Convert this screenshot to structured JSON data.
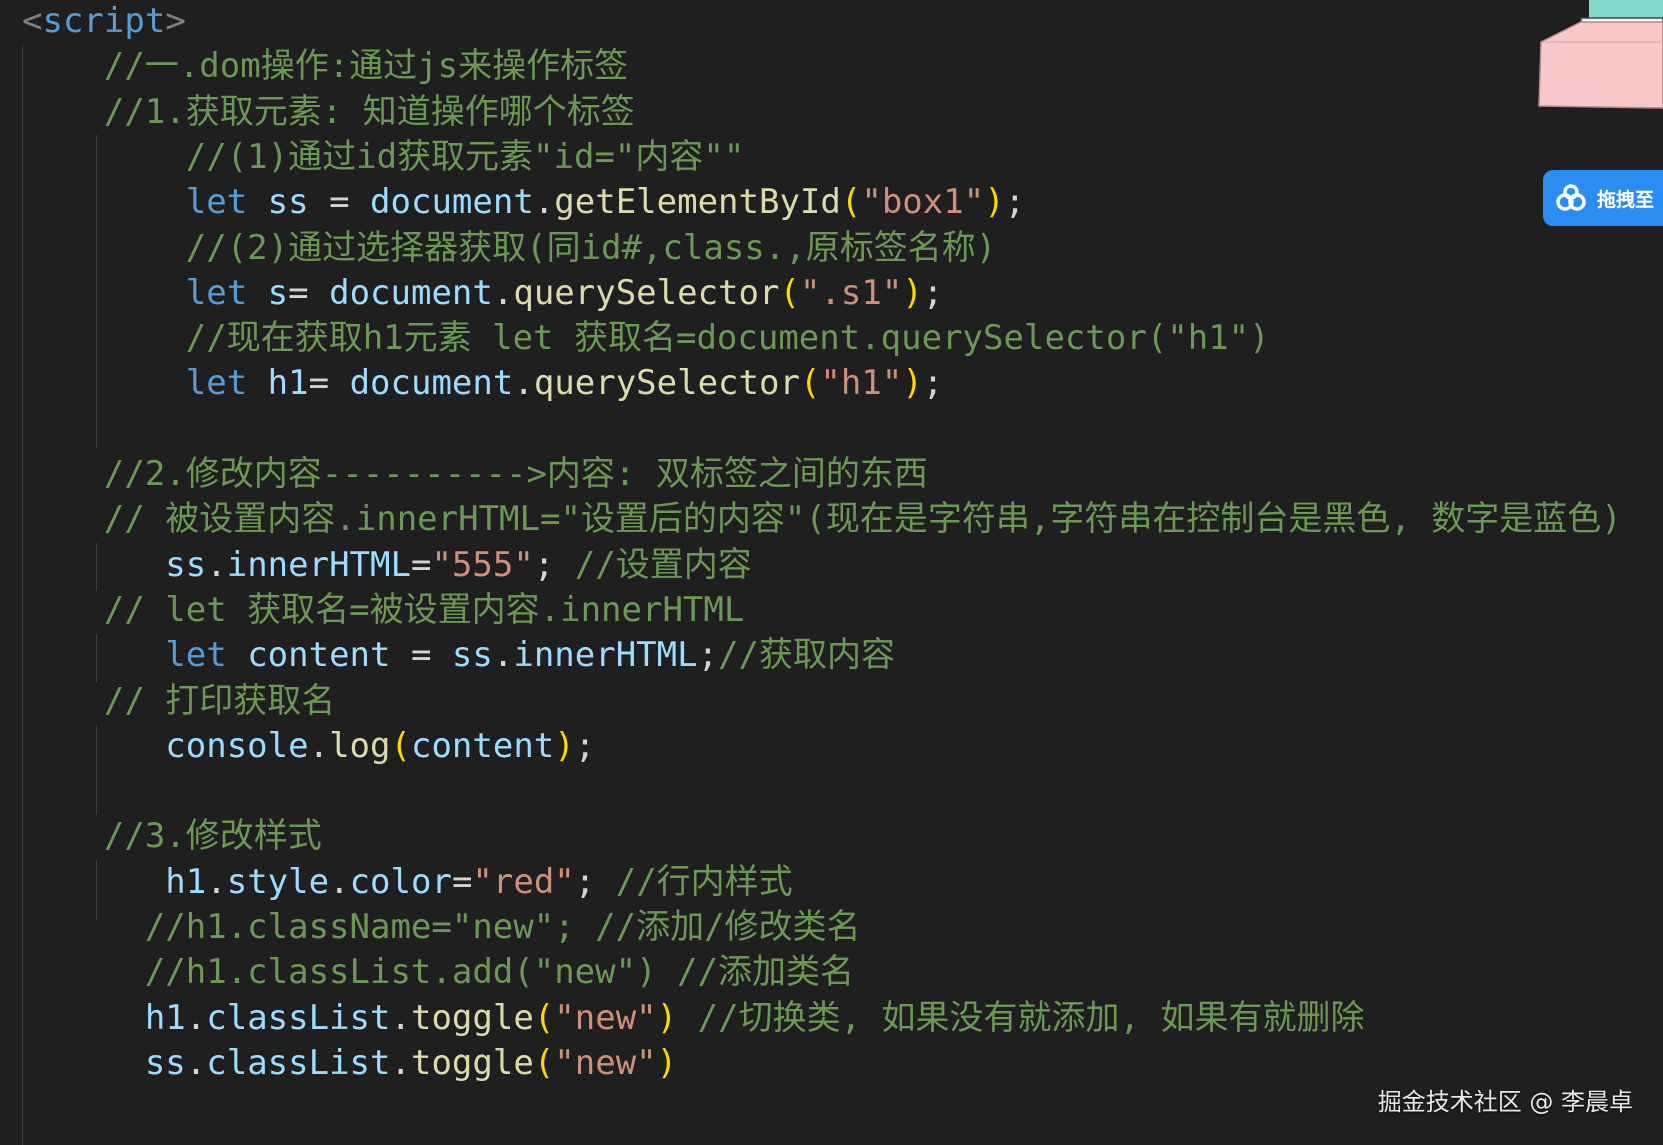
{
  "editor": {
    "colors": {
      "background": "#1f1f1f",
      "comment": "#6a9955",
      "keyword": "#569cd6",
      "variable": "#9cdcfe",
      "function": "#dcdcaa",
      "string": "#ce9178",
      "bracket": "#ffd700",
      "punctuation": "#d4d4d4"
    },
    "lines": [
      [
        {
          "t": "tag",
          "v": "<"
        },
        {
          "t": "tn",
          "v": "script"
        },
        {
          "t": "tag",
          "v": ">"
        }
      ],
      [
        {
          "t": "c",
          "v": "    //一.dom操作:通过js来操作标签"
        }
      ],
      [
        {
          "t": "c",
          "v": "    //1.获取元素: 知道操作哪个标签"
        }
      ],
      [
        {
          "t": "c",
          "v": "        //(1)通过id获取元素\"id=\"内容\"\""
        }
      ],
      [
        {
          "t": "p",
          "v": "        "
        },
        {
          "t": "k",
          "v": "let"
        },
        {
          "t": "p",
          "v": " "
        },
        {
          "t": "v",
          "v": "ss"
        },
        {
          "t": "p",
          "v": " = "
        },
        {
          "t": "v",
          "v": "document"
        },
        {
          "t": "p",
          "v": "."
        },
        {
          "t": "f",
          "v": "getElementById"
        },
        {
          "t": "b",
          "v": "("
        },
        {
          "t": "s",
          "v": "\"box1\""
        },
        {
          "t": "b",
          "v": ")"
        },
        {
          "t": "p",
          "v": ";"
        }
      ],
      [
        {
          "t": "c",
          "v": "        //(2)通过选择器获取(同id#,class.,原标签名称)"
        }
      ],
      [
        {
          "t": "p",
          "v": "        "
        },
        {
          "t": "k",
          "v": "let"
        },
        {
          "t": "p",
          "v": " "
        },
        {
          "t": "v",
          "v": "s"
        },
        {
          "t": "p",
          "v": "= "
        },
        {
          "t": "v",
          "v": "document"
        },
        {
          "t": "p",
          "v": "."
        },
        {
          "t": "f",
          "v": "querySelector"
        },
        {
          "t": "b",
          "v": "("
        },
        {
          "t": "s",
          "v": "\".s1\""
        },
        {
          "t": "b",
          "v": ")"
        },
        {
          "t": "p",
          "v": ";"
        }
      ],
      [
        {
          "t": "c",
          "v": "        //现在获取h1元素 let 获取名=document.querySelector(\"h1\")"
        }
      ],
      [
        {
          "t": "p",
          "v": "        "
        },
        {
          "t": "k",
          "v": "let"
        },
        {
          "t": "p",
          "v": " "
        },
        {
          "t": "v",
          "v": "h1"
        },
        {
          "t": "p",
          "v": "= "
        },
        {
          "t": "v",
          "v": "document"
        },
        {
          "t": "p",
          "v": "."
        },
        {
          "t": "f",
          "v": "querySelector"
        },
        {
          "t": "b",
          "v": "("
        },
        {
          "t": "s",
          "v": "\"h1\""
        },
        {
          "t": "b",
          "v": ")"
        },
        {
          "t": "p",
          "v": ";"
        }
      ],
      [],
      [
        {
          "t": "c",
          "v": "    //2.修改内容---------->内容: 双标签之间的东西"
        }
      ],
      [
        {
          "t": "c",
          "v": "    // 被设置内容.innerHTML=\"设置后的内容\"(现在是字符串,字符串在控制台是黑色, 数字是蓝色)"
        }
      ],
      [
        {
          "t": "p",
          "v": "       "
        },
        {
          "t": "v",
          "v": "ss"
        },
        {
          "t": "p",
          "v": "."
        },
        {
          "t": "v",
          "v": "innerHTML"
        },
        {
          "t": "p",
          "v": "="
        },
        {
          "t": "s",
          "v": "\"555\""
        },
        {
          "t": "p",
          "v": "; "
        },
        {
          "t": "c",
          "v": "//设置内容"
        }
      ],
      [
        {
          "t": "c",
          "v": "    // let 获取名=被设置内容.innerHTML"
        }
      ],
      [
        {
          "t": "p",
          "v": "       "
        },
        {
          "t": "k",
          "v": "let"
        },
        {
          "t": "p",
          "v": " "
        },
        {
          "t": "v",
          "v": "content"
        },
        {
          "t": "p",
          "v": " = "
        },
        {
          "t": "v",
          "v": "ss"
        },
        {
          "t": "p",
          "v": "."
        },
        {
          "t": "v",
          "v": "innerHTML"
        },
        {
          "t": "p",
          "v": ";"
        },
        {
          "t": "c",
          "v": "//获取内容"
        }
      ],
      [
        {
          "t": "c",
          "v": "    // 打印获取名"
        }
      ],
      [
        {
          "t": "p",
          "v": "       "
        },
        {
          "t": "v",
          "v": "console"
        },
        {
          "t": "p",
          "v": "."
        },
        {
          "t": "f",
          "v": "log"
        },
        {
          "t": "b",
          "v": "("
        },
        {
          "t": "v",
          "v": "content"
        },
        {
          "t": "b",
          "v": ")"
        },
        {
          "t": "p",
          "v": ";"
        }
      ],
      [],
      [
        {
          "t": "c",
          "v": "    //3.修改样式"
        }
      ],
      [
        {
          "t": "p",
          "v": "       "
        },
        {
          "t": "v",
          "v": "h1"
        },
        {
          "t": "p",
          "v": "."
        },
        {
          "t": "v",
          "v": "style"
        },
        {
          "t": "p",
          "v": "."
        },
        {
          "t": "v",
          "v": "color"
        },
        {
          "t": "p",
          "v": "="
        },
        {
          "t": "s",
          "v": "\"red\""
        },
        {
          "t": "p",
          "v": "; "
        },
        {
          "t": "c",
          "v": "//行内样式"
        }
      ],
      [
        {
          "t": "c",
          "v": "      //h1.className=\"new\"; //添加/修改类名"
        }
      ],
      [
        {
          "t": "c",
          "v": "      //h1.classList.add(\"new\") //添加类名"
        }
      ],
      [
        {
          "t": "p",
          "v": "      "
        },
        {
          "t": "v",
          "v": "h1"
        },
        {
          "t": "p",
          "v": "."
        },
        {
          "t": "v",
          "v": "classList"
        },
        {
          "t": "p",
          "v": "."
        },
        {
          "t": "f",
          "v": "toggle"
        },
        {
          "t": "b",
          "v": "("
        },
        {
          "t": "s",
          "v": "\"new\""
        },
        {
          "t": "b",
          "v": ")"
        },
        {
          "t": "p",
          "v": " "
        },
        {
          "t": "c",
          "v": "//切换类, 如果没有就添加, 如果有就删除"
        }
      ],
      [
        {
          "t": "p",
          "v": "      "
        },
        {
          "t": "v",
          "v": "ss"
        },
        {
          "t": "p",
          "v": "."
        },
        {
          "t": "v",
          "v": "classList"
        },
        {
          "t": "p",
          "v": "."
        },
        {
          "t": "f",
          "v": "toggle"
        },
        {
          "t": "b",
          "v": "("
        },
        {
          "t": "s",
          "v": "\"new\""
        },
        {
          "t": "b",
          "v": ")"
        }
      ]
    ]
  },
  "overlay": {
    "baidu_button_label": "拖拽至",
    "baidu_icon": "baidu-netdisk-icon",
    "corner_art": "desk-illustration",
    "watermark": "掘金技术社区 @ 李晨卓"
  }
}
